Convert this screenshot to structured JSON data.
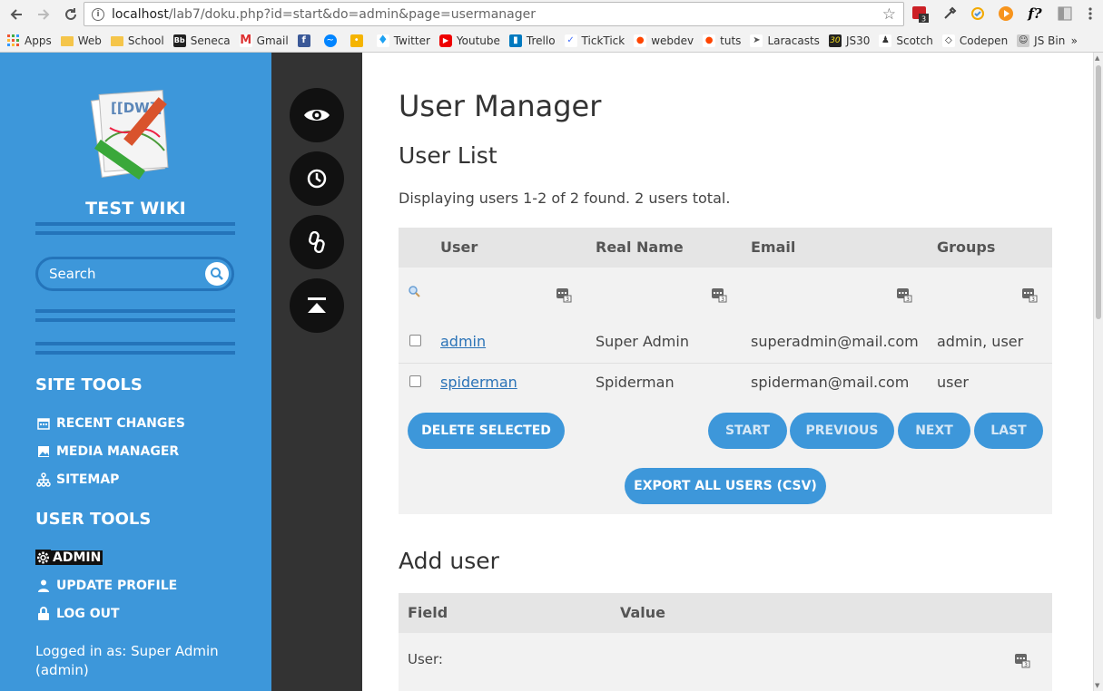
{
  "browser": {
    "url_host": "localhost",
    "url_path": "/lab7/doku.php?id=start&do=admin&page=usermanager",
    "bookmarks": [
      "Apps",
      "Web",
      "School",
      "Seneca",
      "Gmail",
      "Twitter",
      "Youtube",
      "Trello",
      "TickTick",
      "webdev",
      "tuts",
      "Laracasts",
      "JS30",
      "Scotch",
      "Codepen",
      "JS Bin"
    ],
    "more": "»",
    "ext_f_label": "f?",
    "ext_badge": "3"
  },
  "sidebar": {
    "wiki_title": "TEST WIKI",
    "logo_text": "[[DW]]",
    "search_placeholder": "Search",
    "site_tools_heading": "SITE TOOLS",
    "site_tools": [
      "RECENT CHANGES",
      "MEDIA MANAGER",
      "SITEMAP"
    ],
    "user_tools_heading": "USER TOOLS",
    "user_tools": [
      "ADMIN",
      "UPDATE PROFILE",
      "LOG OUT"
    ],
    "logged_in": "Logged in as: Super Admin (admin)"
  },
  "main": {
    "title": "User Manager",
    "user_list_heading": "User List",
    "info": "Displaying users 1-2 of 2 found. 2 users total.",
    "columns": [
      "User",
      "Real Name",
      "Email",
      "Groups"
    ],
    "users": [
      {
        "user": "admin",
        "name": "Super Admin",
        "email": "superadmin@mail.com",
        "groups": "admin, user"
      },
      {
        "user": "spiderman",
        "name": "Spiderman",
        "email": "spiderman@mail.com",
        "groups": "user"
      }
    ],
    "buttons": {
      "delete": "DELETE SELECTED",
      "start": "START",
      "previous": "PREVIOUS",
      "next": "NEXT",
      "last": "LAST",
      "export": "EXPORT ALL USERS (CSV)"
    },
    "add_user_heading": "Add user",
    "add_columns": [
      "Field",
      "Value"
    ],
    "add_fields": [
      "User:"
    ]
  },
  "colors": {
    "sidebar": "#3d97da",
    "rail": "#333333",
    "accent": "#3d97da"
  }
}
